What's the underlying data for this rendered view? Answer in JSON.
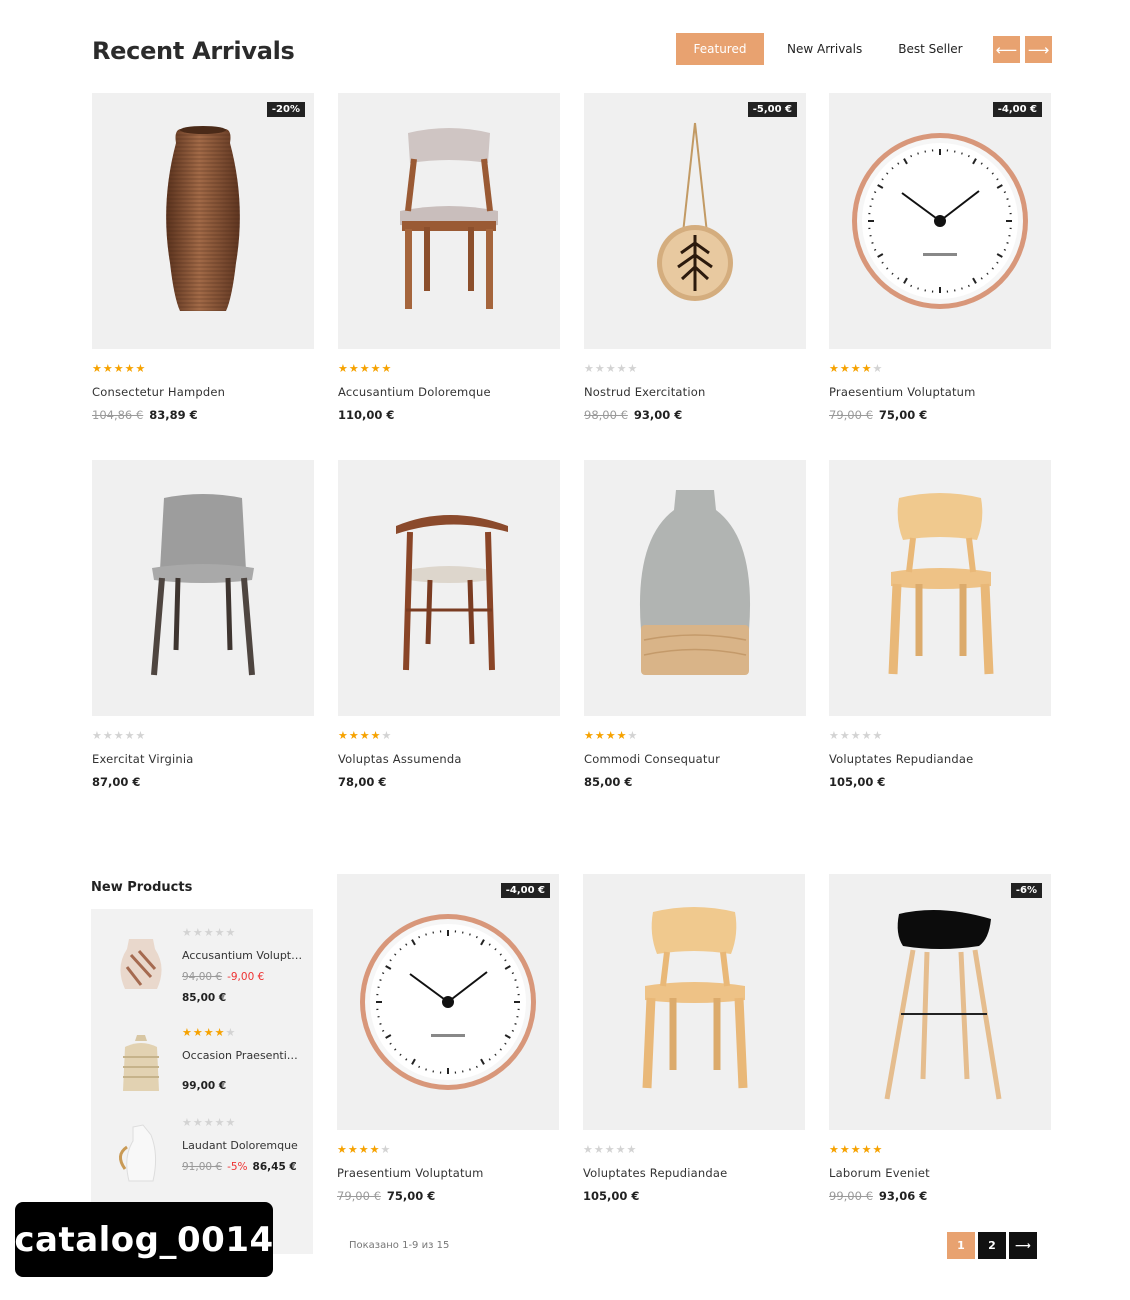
{
  "header": {
    "title": "Recent Arrivals",
    "tabs": [
      {
        "label": "Featured",
        "active": true
      },
      {
        "label": "New Arrivals",
        "active": false
      },
      {
        "label": "Best Seller",
        "active": false
      }
    ],
    "prev_icon": "arrow-left-icon",
    "next_icon": "arrow-right-icon",
    "prev_glyph": "⟵",
    "next_glyph": "⟶"
  },
  "products": [
    {
      "name": "Consectetur Hampden",
      "badge": "-20%",
      "rating": 5,
      "old_price": "104,86 €",
      "price": "83,89 €",
      "image": "rope-vase"
    },
    {
      "name": "Accusantium Doloremque",
      "badge": "",
      "rating": 5,
      "old_price": "",
      "price": "110,00 €",
      "image": "upholstered-chair"
    },
    {
      "name": "Nostrud Exercitation",
      "badge": "-5,00 €",
      "rating": 0,
      "old_price": "98,00 €",
      "price": "93,00 €",
      "image": "wood-ornament"
    },
    {
      "name": "Praesentium Voluptatum",
      "badge": "-4,00 €",
      "rating": 4,
      "old_price": "79,00 €",
      "price": "75,00 €",
      "image": "wall-clock"
    },
    {
      "name": "Exercitat Virginia",
      "badge": "",
      "rating": 0,
      "old_price": "",
      "price": "87,00 €",
      "image": "grey-chair"
    },
    {
      "name": "Voluptas Assumenda",
      "badge": "",
      "rating": 4,
      "old_price": "",
      "price": "78,00 €",
      "image": "walnut-chair"
    },
    {
      "name": "Commodi Consequatur",
      "badge": "",
      "rating": 4,
      "old_price": "",
      "price": "85,00 €",
      "image": "glass-vase"
    },
    {
      "name": "Voluptates Repudiandae",
      "badge": "",
      "rating": 0,
      "old_price": "",
      "price": "105,00 €",
      "image": "plywood-chair"
    }
  ],
  "new_products": {
    "title": "New Products",
    "items": [
      {
        "name": "Accusantium Voluptatem",
        "rating": 0,
        "old_price": "94,00 €",
        "discount": "-9,00 €",
        "price": "85,00 €",
        "image": "ceramic-vase"
      },
      {
        "name": "Occasion Praesentium",
        "rating": 4,
        "old_price": "",
        "discount": "",
        "price": "99,00 €",
        "image": "woven-basket"
      },
      {
        "name": "Laudant Doloremque",
        "rating": 0,
        "old_price": "91,00 €",
        "discount": "-5%",
        "price": "86,45 €",
        "image": "white-pitcher"
      }
    ]
  },
  "shop_products": [
    {
      "name": "Praesentium Voluptatum",
      "badge": "-4,00 €",
      "rating": 4,
      "old_price": "79,00 €",
      "price": "75,00 €",
      "image": "wall-clock"
    },
    {
      "name": "Voluptates Repudiandae",
      "badge": "",
      "rating": 0,
      "old_price": "",
      "price": "105,00 €",
      "image": "plywood-chair"
    },
    {
      "name": "Laborum Eveniet",
      "badge": "-6%",
      "rating": 5,
      "old_price": "99,00 €",
      "price": "93,06 €",
      "image": "bar-stool"
    }
  ],
  "results": {
    "text": "Показано 1-9 из 15"
  },
  "pagination": {
    "pages": [
      "1",
      "2"
    ],
    "active": "1",
    "next_icon": "arrow-right-icon",
    "next_glyph": "⟶"
  },
  "watermark": "catalog_0014",
  "colors": {
    "accent": "#e8a270",
    "star": "#f6a200",
    "badge_bg": "#222222",
    "card_bg": "#f0f0f0"
  }
}
